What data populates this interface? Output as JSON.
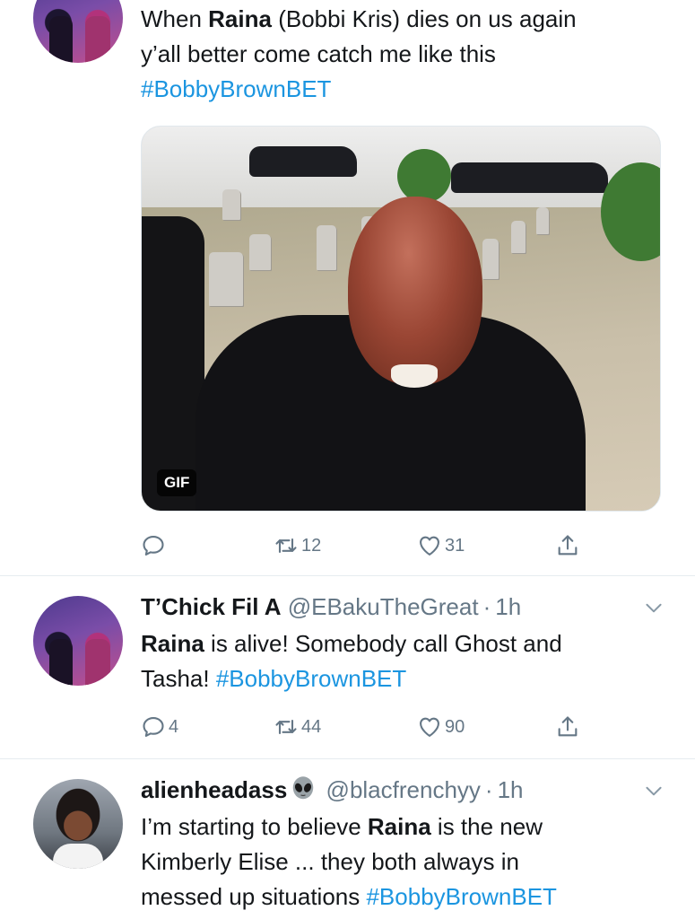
{
  "tweets": [
    {
      "text_parts": [
        "When ",
        "Raina",
        " (Bobbi Kris) dies on us again",
        "y’all better come catch me like this",
        "#BobbyBrownBET"
      ],
      "media": {
        "badge": "GIF"
      },
      "actions": {
        "reply": "",
        "retweet": "12",
        "like": "31"
      }
    },
    {
      "name": "T’Chick Fil A",
      "handle": "@EBakuTheGreat",
      "dot": "·",
      "time": "1h",
      "text_parts": [
        "Raina",
        " is alive! Somebody call Ghost and",
        "Tasha! ",
        "#BobbyBrownBET"
      ],
      "actions": {
        "reply": "4",
        "retweet": "44",
        "like": "90"
      }
    },
    {
      "name": "alienheadass",
      "name_emoji": "alien-icon",
      "handle": "@blacfrenchyy",
      "dot": "·",
      "time": "1h",
      "text_parts": [
        "I’m starting to believe ",
        "Raina",
        " is the new",
        "Kimberly Elise ... they both always in",
        "messed up situations ",
        "#BobbyBrownBET"
      ]
    }
  ],
  "colors": {
    "hashtag": "#1b95e0",
    "secondary_text": "#657786",
    "divider": "#e6ecf0"
  }
}
